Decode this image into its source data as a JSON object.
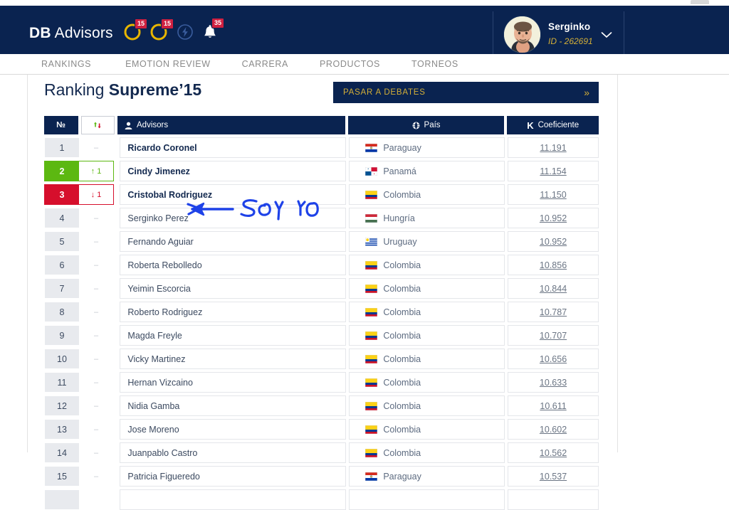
{
  "header": {
    "brand_bold": "DB",
    "brand_light": " Advisors",
    "icons": [
      {
        "name": "emotion-happy-icon",
        "badge": "15"
      },
      {
        "name": "emotion-sad-icon",
        "badge": "15"
      },
      {
        "name": "flash-icon",
        "badge": ""
      },
      {
        "name": "bell-icon",
        "badge": "35"
      }
    ],
    "user": {
      "name": "Serginko",
      "id": "ID - 262691",
      "chevron": "chevron-down-icon"
    }
  },
  "nav": {
    "items": [
      {
        "label": "RANKINGS"
      },
      {
        "label": "EMOTION REVIEW"
      },
      {
        "label": "CARRERA"
      },
      {
        "label": "PRODUCTOS"
      },
      {
        "label": "TORNEOS"
      }
    ]
  },
  "main": {
    "title_thin": "Ranking ",
    "title_bold": "Supreme’15",
    "debates_button": {
      "label": "PASAR A DEBATES",
      "chevron": "»"
    },
    "table": {
      "headers": {
        "num": "№",
        "sort": "sort-arrows-icon",
        "advisors": "Advisors",
        "pais": "País",
        "coeficiente": "Coeficiente"
      },
      "rows": [
        {
          "rank": "1",
          "move": "–",
          "move_dir": "none",
          "name": "Ricardo Coronel",
          "bold": true,
          "country": "Paraguay",
          "flag": "py",
          "coef": "11.191"
        },
        {
          "rank": "2",
          "move": "1",
          "move_dir": "up",
          "name": "Cindy Jimenez",
          "bold": true,
          "country": "Panamá",
          "flag": "pa",
          "coef": "11.154"
        },
        {
          "rank": "3",
          "move": "1",
          "move_dir": "down",
          "name": "Cristobal Rodriguez",
          "bold": true,
          "country": "Colombia",
          "flag": "co",
          "coef": "11.150"
        },
        {
          "rank": "4",
          "move": "–",
          "move_dir": "none",
          "name": "Serginko Perez",
          "bold": false,
          "country": "Hungría",
          "flag": "hu",
          "coef": "10.952"
        },
        {
          "rank": "5",
          "move": "–",
          "move_dir": "none",
          "name": "Fernando Aguiar",
          "bold": false,
          "country": "Uruguay",
          "flag": "uy",
          "coef": "10.952"
        },
        {
          "rank": "6",
          "move": "–",
          "move_dir": "none",
          "name": "Roberta Rebolledo",
          "bold": false,
          "country": "Colombia",
          "flag": "co",
          "coef": "10.856"
        },
        {
          "rank": "7",
          "move": "–",
          "move_dir": "none",
          "name": "Yeimin Escorcia",
          "bold": false,
          "country": "Colombia",
          "flag": "co",
          "coef": "10.844"
        },
        {
          "rank": "8",
          "move": "–",
          "move_dir": "none",
          "name": "Roberto Rodriguez",
          "bold": false,
          "country": "Colombia",
          "flag": "co",
          "coef": "10.787"
        },
        {
          "rank": "9",
          "move": "–",
          "move_dir": "none",
          "name": "Magda Freyle",
          "bold": false,
          "country": "Colombia",
          "flag": "co",
          "coef": "10.707"
        },
        {
          "rank": "10",
          "move": "–",
          "move_dir": "none",
          "name": "Vicky Martinez",
          "bold": false,
          "country": "Colombia",
          "flag": "co",
          "coef": "10.656"
        },
        {
          "rank": "11",
          "move": "–",
          "move_dir": "none",
          "name": "Hernan Vizcaino",
          "bold": false,
          "country": "Colombia",
          "flag": "co",
          "coef": "10.633"
        },
        {
          "rank": "12",
          "move": "–",
          "move_dir": "none",
          "name": "Nidia Gamba",
          "bold": false,
          "country": "Colombia",
          "flag": "co",
          "coef": "10.611"
        },
        {
          "rank": "13",
          "move": "–",
          "move_dir": "none",
          "name": "Jose Moreno",
          "bold": false,
          "country": "Colombia",
          "flag": "co",
          "coef": "10.602"
        },
        {
          "rank": "14",
          "move": "–",
          "move_dir": "none",
          "name": "Juanpablo Castro",
          "bold": false,
          "country": "Colombia",
          "flag": "co",
          "coef": "10.562"
        },
        {
          "rank": "15",
          "move": "–",
          "move_dir": "none",
          "name": "Patricia Figueredo",
          "bold": false,
          "country": "Paraguay",
          "flag": "py",
          "coef": "10.537"
        },
        {
          "rank": "",
          "move": "",
          "move_dir": "none",
          "name": "",
          "bold": false,
          "country": "",
          "flag": "",
          "coef": ""
        }
      ]
    }
  },
  "annotation": {
    "text": "SOY YO",
    "color": "#1e42e8",
    "target_row": 4
  },
  "colors": {
    "navy": "#0a2350",
    "gold": "#d4af37",
    "green": "#5cb811",
    "red": "#d60f2c",
    "badge_red": "#cf2040"
  }
}
